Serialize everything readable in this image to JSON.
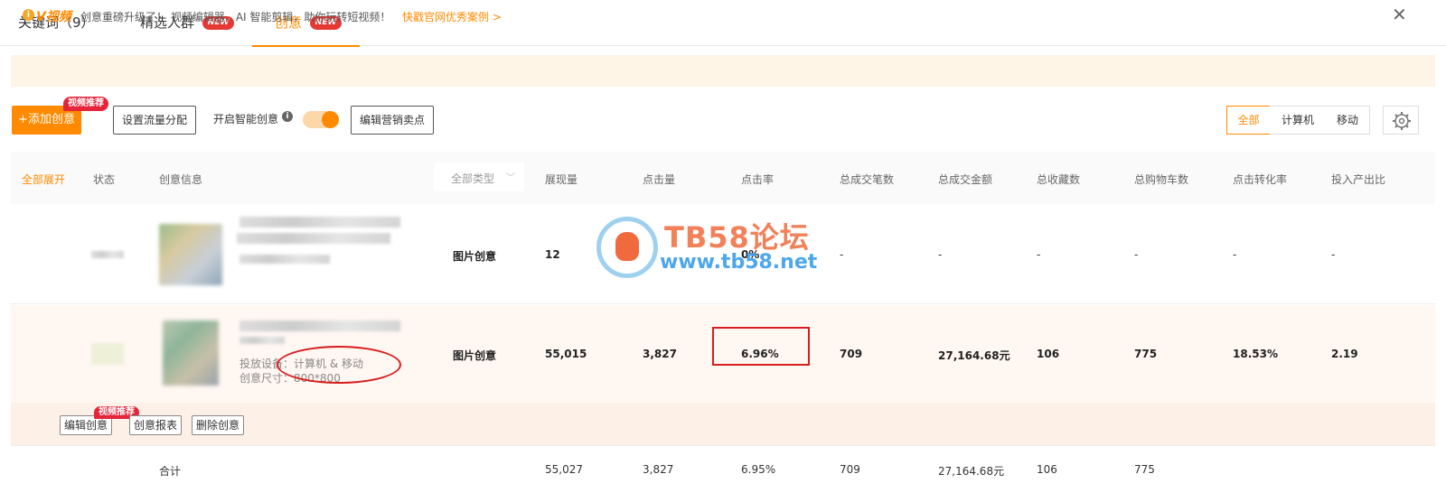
{
  "tabs": [
    {
      "label": "关键词（9）",
      "badge": ""
    },
    {
      "label": "精选人群",
      "badge": "NEW"
    },
    {
      "label": "创意",
      "badge": "NEW"
    }
  ],
  "notice": {
    "brand": "V视频",
    "text": "创意重磅升级了！ 视频编辑器，AI 智能剪辑，助你玩转短视频！",
    "link": "快戳官网优秀案例 >",
    "close": "✕"
  },
  "toolbar": {
    "add_label": "+添加创意",
    "add_badge": "视频推荐",
    "traffic_label": "设置流量分配",
    "smart_label": "开启智能创意",
    "selling_label": "编辑营销卖点",
    "segments": [
      "全部",
      "计算机",
      "移动"
    ]
  },
  "table": {
    "headers": {
      "expand": "全部展开",
      "status": "状态",
      "info": "创意信息",
      "type_filter": "全部类型",
      "impressions": "展现量",
      "clicks": "点击量",
      "ctr": "点击率",
      "orders": "总成交笔数",
      "gmv": "总成交金额",
      "favorites": "总收藏数",
      "carts": "总购物车数",
      "cvr": "点击转化率",
      "roi": "投入产出比"
    },
    "rows": [
      {
        "type": "图片创意",
        "impressions": "12",
        "clicks": "0",
        "ctr": "0%",
        "orders": "-",
        "gmv": "-",
        "favorites": "-",
        "carts": "-",
        "cvr": "-",
        "roi": "-"
      },
      {
        "type": "图片创意",
        "impressions": "55,015",
        "clicks": "3,827",
        "ctr": "6.96%",
        "orders": "709",
        "gmv": "27,164.68元",
        "favorites": "106",
        "carts": "775",
        "cvr": "18.53%",
        "roi": "2.19",
        "device_label": "投放设备：",
        "device_value": "计算机 & 移动",
        "size_label": "创意尺寸：",
        "size_value": "800*800"
      }
    ],
    "actions": {
      "edit": "编辑创意",
      "edit_badge": "视频推荐",
      "report": "创意报表",
      "delete": "删除创意"
    },
    "total": {
      "label": "合计",
      "impressions": "55,027",
      "clicks": "3,827",
      "ctr": "6.95%",
      "orders": "709",
      "gmv": "27,164.68元",
      "favorites": "106",
      "carts": "775"
    }
  },
  "watermark": {
    "title": "TB58论坛",
    "url": "www.tb58.net"
  },
  "colors": {
    "accent": "#ff8a00",
    "badge": "#e53935",
    "annotation": "#d81e1e"
  }
}
